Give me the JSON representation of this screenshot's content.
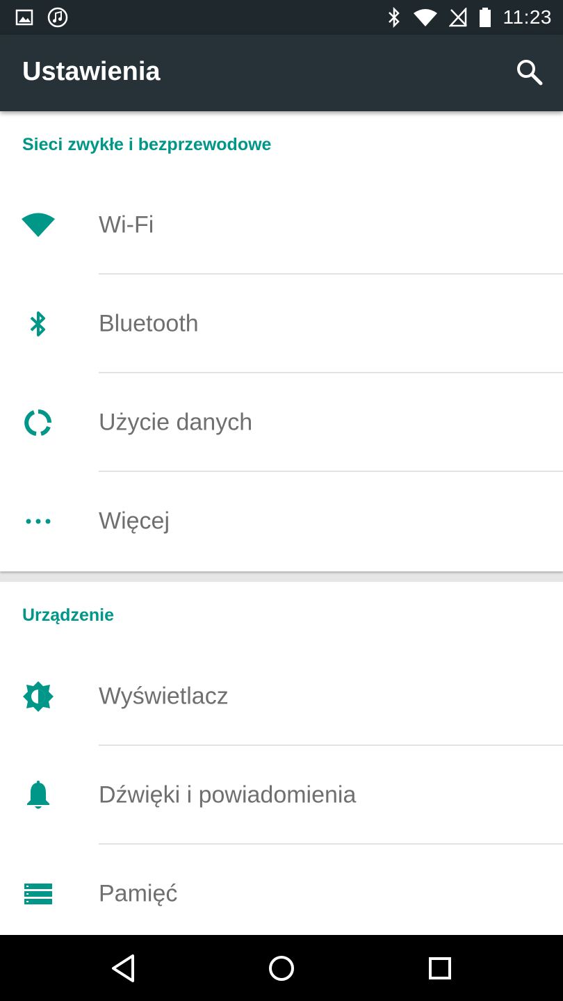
{
  "status_bar": {
    "time": "11:23",
    "left_icons": [
      "image-notification-icon",
      "music-notification-icon"
    ],
    "right_icons": [
      "bluetooth-icon",
      "wifi-signal-icon",
      "no-signal-icon",
      "battery-icon"
    ]
  },
  "app_bar": {
    "title": "Ustawienia",
    "search_icon": "search-icon"
  },
  "accent_color": "#009688",
  "sections": [
    {
      "title": "Sieci zwykłe i bezprzewodowe",
      "items": [
        {
          "label": "Wi-Fi",
          "icon": "wifi-icon"
        },
        {
          "label": "Bluetooth",
          "icon": "bluetooth-icon"
        },
        {
          "label": "Użycie danych",
          "icon": "data-usage-icon"
        },
        {
          "label": "Więcej",
          "icon": "more-icon"
        }
      ]
    },
    {
      "title": "Urządzenie",
      "items": [
        {
          "label": "Wyświetlacz",
          "icon": "brightness-icon"
        },
        {
          "label": "Dźwięki i powiadomienia",
          "icon": "bell-icon"
        },
        {
          "label": "Pamięć",
          "icon": "storage-icon"
        }
      ]
    }
  ],
  "nav_bar": [
    "back-icon",
    "home-icon",
    "recents-icon"
  ]
}
